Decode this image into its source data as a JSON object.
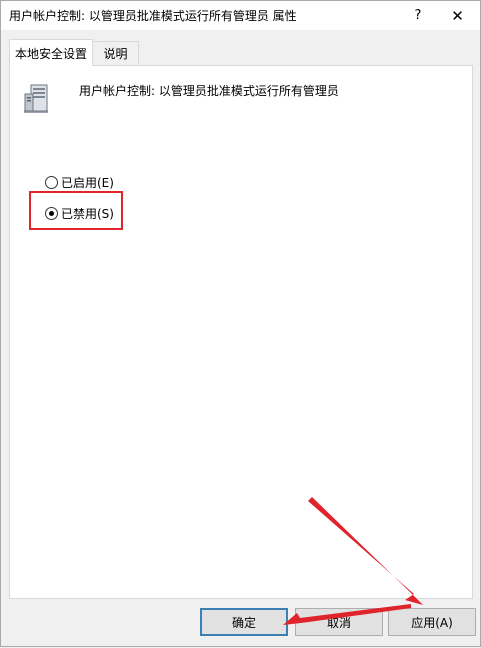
{
  "window": {
    "title": "用户帐户控制: 以管理员批准模式运行所有管理员 属性",
    "help_label": "?",
    "close_label": "✕"
  },
  "tabs": [
    {
      "label": "本地安全设置",
      "active": true
    },
    {
      "label": "说明",
      "active": false
    }
  ],
  "policy": {
    "icon": "server-policy-icon",
    "name": "用户帐户控制: 以管理员批准模式运行所有管理员"
  },
  "options": [
    {
      "label": "已启用(E)",
      "selected": false
    },
    {
      "label": "已禁用(S)",
      "selected": true
    }
  ],
  "buttons": {
    "ok": "确定",
    "cancel": "取消",
    "apply": "应用(A)"
  },
  "annotation_color": "#e0242b"
}
